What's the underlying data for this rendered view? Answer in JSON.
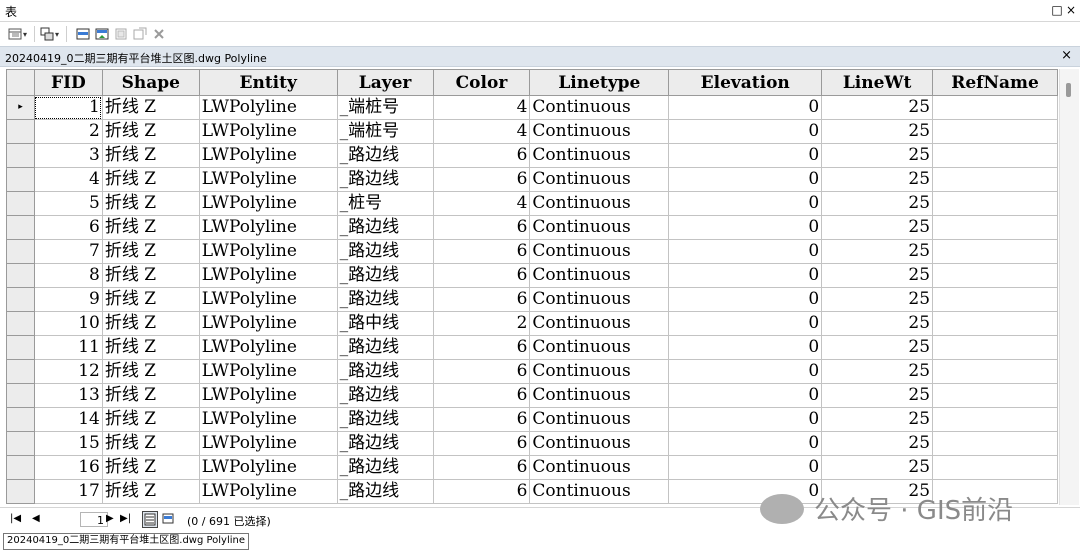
{
  "window": {
    "title": "表",
    "restore_glyph": "□",
    "close_glyph": "×"
  },
  "tab": {
    "label": "20240419_0二期三期有平台堆土区图.dwg Polyline",
    "close_glyph": "×"
  },
  "columns": [
    "FID",
    "Shape",
    "Entity",
    "Layer",
    "Color",
    "Linetype",
    "Elevation",
    "LineWt",
    "RefName"
  ],
  "rows": [
    {
      "fid": "1",
      "shape": "折线 Z",
      "entity": "LWPolyline",
      "layer": "_端桩号",
      "color": "4",
      "linetype": "Continuous",
      "elevation": "0",
      "linewt": "25",
      "refname": ""
    },
    {
      "fid": "2",
      "shape": "折线 Z",
      "entity": "LWPolyline",
      "layer": "_端桩号",
      "color": "4",
      "linetype": "Continuous",
      "elevation": "0",
      "linewt": "25",
      "refname": ""
    },
    {
      "fid": "3",
      "shape": "折线 Z",
      "entity": "LWPolyline",
      "layer": "_路边线",
      "color": "6",
      "linetype": "Continuous",
      "elevation": "0",
      "linewt": "25",
      "refname": ""
    },
    {
      "fid": "4",
      "shape": "折线 Z",
      "entity": "LWPolyline",
      "layer": "_路边线",
      "color": "6",
      "linetype": "Continuous",
      "elevation": "0",
      "linewt": "25",
      "refname": ""
    },
    {
      "fid": "5",
      "shape": "折线 Z",
      "entity": "LWPolyline",
      "layer": "_桩号",
      "color": "4",
      "linetype": "Continuous",
      "elevation": "0",
      "linewt": "25",
      "refname": ""
    },
    {
      "fid": "6",
      "shape": "折线 Z",
      "entity": "LWPolyline",
      "layer": "_路边线",
      "color": "6",
      "linetype": "Continuous",
      "elevation": "0",
      "linewt": "25",
      "refname": ""
    },
    {
      "fid": "7",
      "shape": "折线 Z",
      "entity": "LWPolyline",
      "layer": "_路边线",
      "color": "6",
      "linetype": "Continuous",
      "elevation": "0",
      "linewt": "25",
      "refname": ""
    },
    {
      "fid": "8",
      "shape": "折线 Z",
      "entity": "LWPolyline",
      "layer": "_路边线",
      "color": "6",
      "linetype": "Continuous",
      "elevation": "0",
      "linewt": "25",
      "refname": ""
    },
    {
      "fid": "9",
      "shape": "折线 Z",
      "entity": "LWPolyline",
      "layer": "_路边线",
      "color": "6",
      "linetype": "Continuous",
      "elevation": "0",
      "linewt": "25",
      "refname": ""
    },
    {
      "fid": "10",
      "shape": "折线 Z",
      "entity": "LWPolyline",
      "layer": "_路中线",
      "color": "2",
      "linetype": "Continuous",
      "elevation": "0",
      "linewt": "25",
      "refname": ""
    },
    {
      "fid": "11",
      "shape": "折线 Z",
      "entity": "LWPolyline",
      "layer": "_路边线",
      "color": "6",
      "linetype": "Continuous",
      "elevation": "0",
      "linewt": "25",
      "refname": ""
    },
    {
      "fid": "12",
      "shape": "折线 Z",
      "entity": "LWPolyline",
      "layer": "_路边线",
      "color": "6",
      "linetype": "Continuous",
      "elevation": "0",
      "linewt": "25",
      "refname": ""
    },
    {
      "fid": "13",
      "shape": "折线 Z",
      "entity": "LWPolyline",
      "layer": "_路边线",
      "color": "6",
      "linetype": "Continuous",
      "elevation": "0",
      "linewt": "25",
      "refname": ""
    },
    {
      "fid": "14",
      "shape": "折线 Z",
      "entity": "LWPolyline",
      "layer": "_路边线",
      "color": "6",
      "linetype": "Continuous",
      "elevation": "0",
      "linewt": "25",
      "refname": ""
    },
    {
      "fid": "15",
      "shape": "折线 Z",
      "entity": "LWPolyline",
      "layer": "_路边线",
      "color": "6",
      "linetype": "Continuous",
      "elevation": "0",
      "linewt": "25",
      "refname": ""
    },
    {
      "fid": "16",
      "shape": "折线 Z",
      "entity": "LWPolyline",
      "layer": "_路边线",
      "color": "6",
      "linetype": "Continuous",
      "elevation": "0",
      "linewt": "25",
      "refname": ""
    },
    {
      "fid": "17",
      "shape": "折线 Z",
      "entity": "LWPolyline",
      "layer": "_路边线",
      "color": "6",
      "linetype": "Continuous",
      "elevation": "0",
      "linewt": "25",
      "refname": ""
    }
  ],
  "navigator": {
    "current_record": "1",
    "status": "(0 / 691 已选择)"
  },
  "bottom_tab": {
    "label": "20240419_0二期三期有平台堆土区图.dwg Polyline"
  },
  "watermark": {
    "text": "公众号 · GIS前沿"
  },
  "icons": {
    "table_options": "table-options-icon",
    "related_tables": "related-tables-icon",
    "select_by_attributes": "select-by-attributes-icon",
    "switch_selection": "switch-selection-icon",
    "clear_selection": "clear-selection-icon",
    "zoom_to_selected": "zoom-to-selected-icon",
    "delete_selected": "delete-selected-icon"
  },
  "colors": {
    "header_bg": "#ececec",
    "tabstrip_bg": "#dfe6ee",
    "grid_line": "#c3c3c3"
  }
}
